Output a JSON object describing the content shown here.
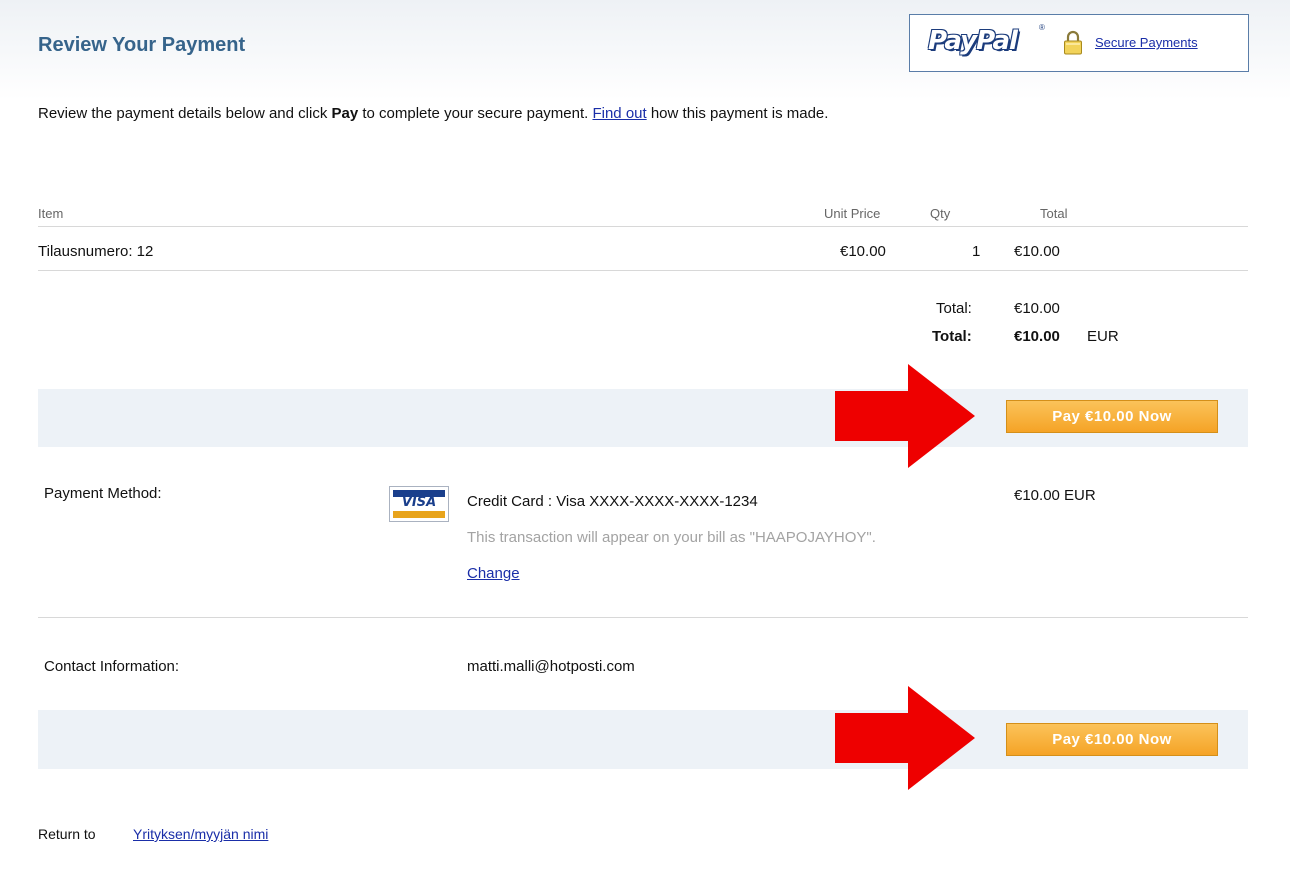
{
  "header": {
    "title": "Review Your Payment",
    "paypal_logo": "PayPal",
    "paypal_tm": "®",
    "secure_link": "Secure Payments"
  },
  "intro": {
    "text_before": "Review the payment details below and click ",
    "bold_word": "Pay",
    "text_middle": " to complete your secure payment. ",
    "link_text": "Find out",
    "text_after": " how this payment is made."
  },
  "table": {
    "headers": {
      "item": "Item",
      "unit_price": "Unit Price",
      "qty": "Qty",
      "total": "Total"
    },
    "rows": [
      {
        "item": "Tilausnumero: 12",
        "unit_price": "€10.00",
        "qty": "1",
        "total": "€10.00"
      }
    ],
    "subtotal_label": "Total:",
    "subtotal_value": "€10.00",
    "grand_total_label": "Total:",
    "grand_total_value": "€10.00",
    "currency": "EUR"
  },
  "pay_button_label": "Pay €10.00 Now",
  "payment_method": {
    "label": "Payment Method:",
    "card_brand": "VISA",
    "card_text": "Credit Card : Visa XXXX-XXXX-XXXX-1234",
    "note": "This transaction will appear on your bill as \"HAAPOJAYHOY\".",
    "change_link": "Change",
    "amount": "€10.00 EUR"
  },
  "contact": {
    "label": "Contact Information:",
    "email": "matti.malli@hotposti.com"
  },
  "footer": {
    "return_text": "Return to ",
    "merchant_link": "Yrityksen/myyjän nimi"
  },
  "colors": {
    "title": "#36648b",
    "link": "#1a2ea8",
    "button": "#f5a326",
    "arrow": "#ee0000",
    "band": "#edf2f7"
  },
  "icons": [
    "paypal-logo",
    "lock-icon",
    "visa-card-icon",
    "arrow-right-icon"
  ]
}
